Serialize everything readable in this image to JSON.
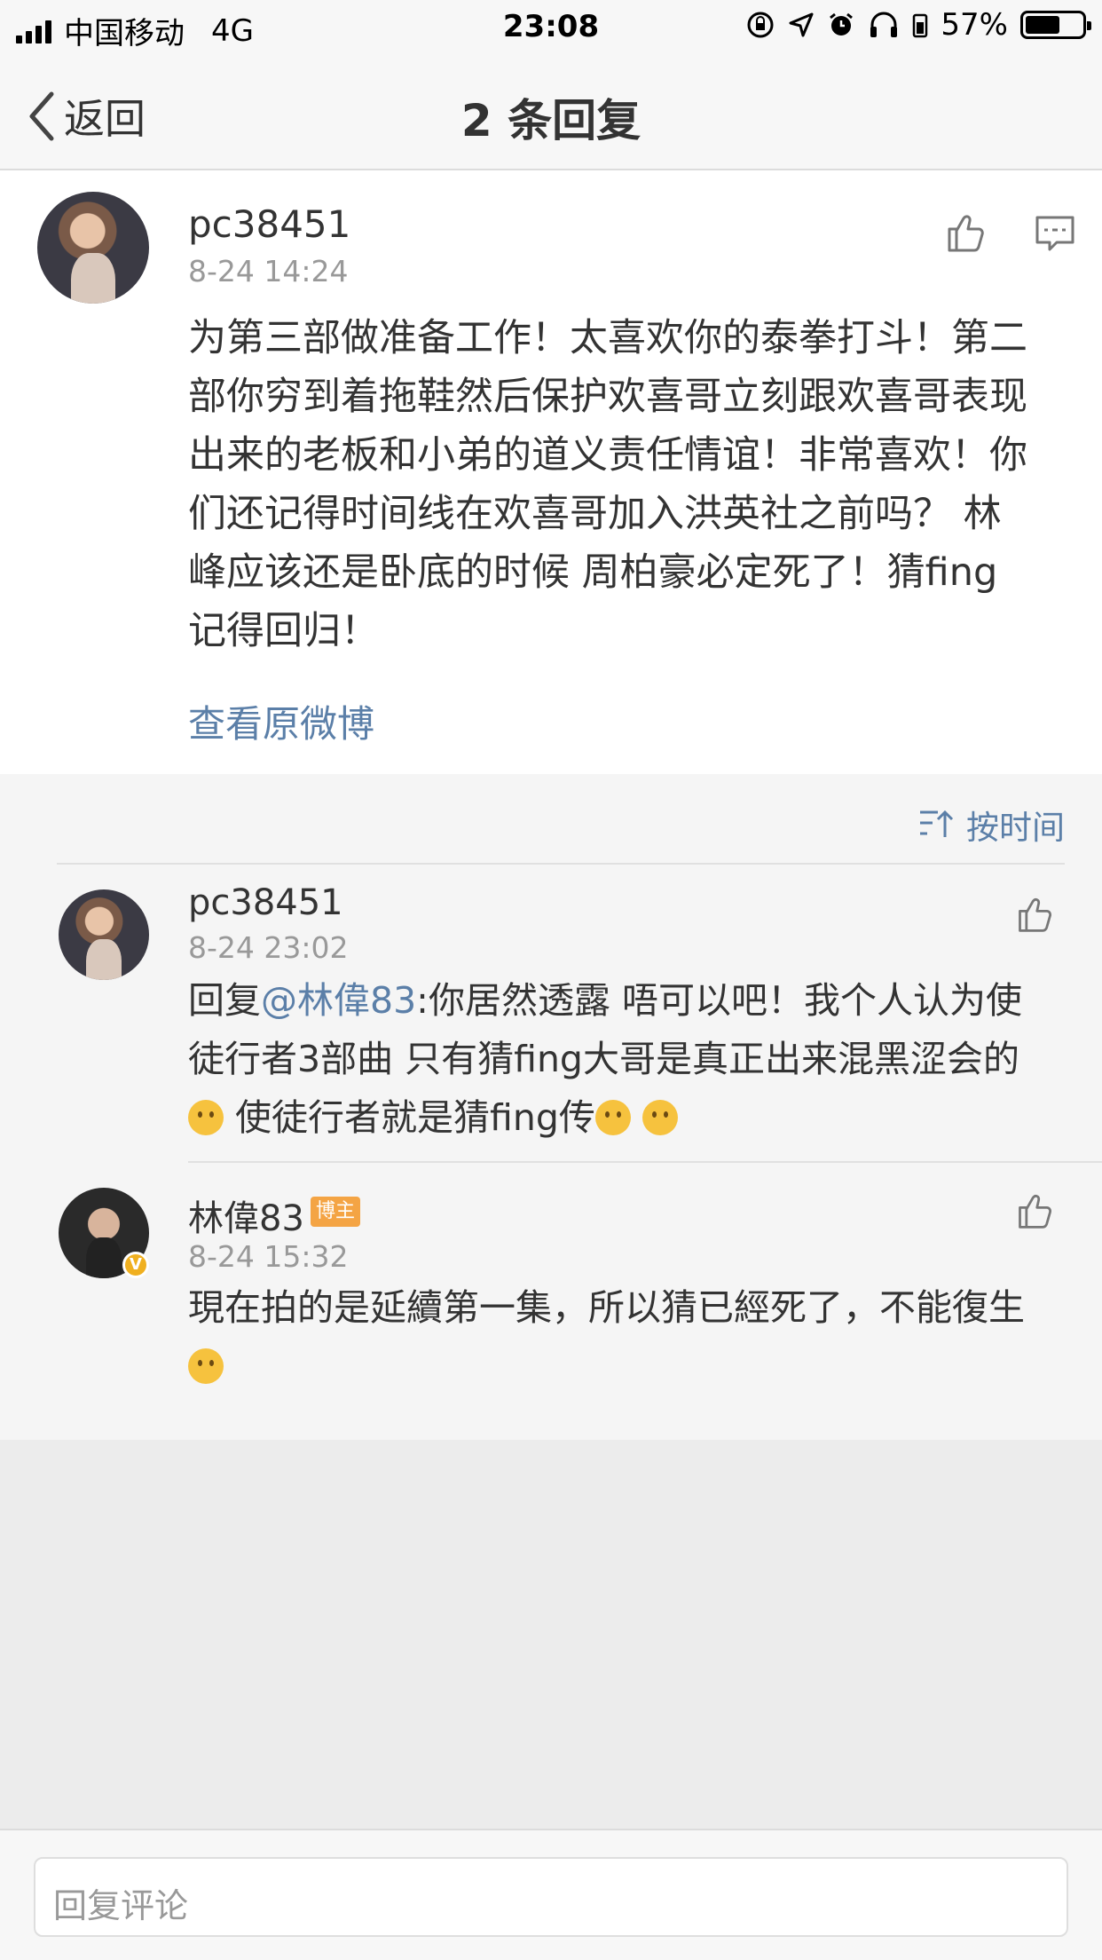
{
  "status_bar": {
    "carrier": "中国移动",
    "network": "4G",
    "time": "23:08",
    "battery": "57%",
    "battery_level": 0.57
  },
  "nav": {
    "back_label": "返回",
    "title": "2 条回复"
  },
  "main_comment": {
    "username": "pc38451",
    "time": "8-24 14:24",
    "lines": [
      "为第三部做准备工作！太喜欢你的泰拳打斗！第二",
      "部你穷到着拖鞋然后保护欢喜哥立刻跟欢喜哥表现",
      "出来的老板和小弟的道义责任情谊！非常喜欢！你",
      "们还记得时间线在欢喜哥加入洪英社之前吗？ 林",
      "峰应该还是卧底的时候 周柏豪必定死了！猜fing",
      "记得回归！"
    ],
    "view_original": "查看原微博"
  },
  "sort_label": "按时间",
  "replies": [
    {
      "username": "pc38451",
      "time": "8-24 23:02",
      "line1_prefix": "回复",
      "mention": "@林偉83",
      "line1_rest": ":你居然透露 唔可以吧！我个人认为使",
      "line2": "徒行者3部曲 只有猜fing大哥是真正出来混黑涩会的",
      "line3": " 使徒行者就是猜fing传"
    },
    {
      "username": "林偉83",
      "badge": "博主",
      "verified": "V",
      "time": "8-24 15:32",
      "line1": "現在拍的是延續第一集，所以猜已經死了，不能復生"
    }
  ],
  "reply_input": {
    "placeholder": "回复评论"
  },
  "colors": {
    "link": "#5b7fa8",
    "badge": "#f4a444"
  }
}
